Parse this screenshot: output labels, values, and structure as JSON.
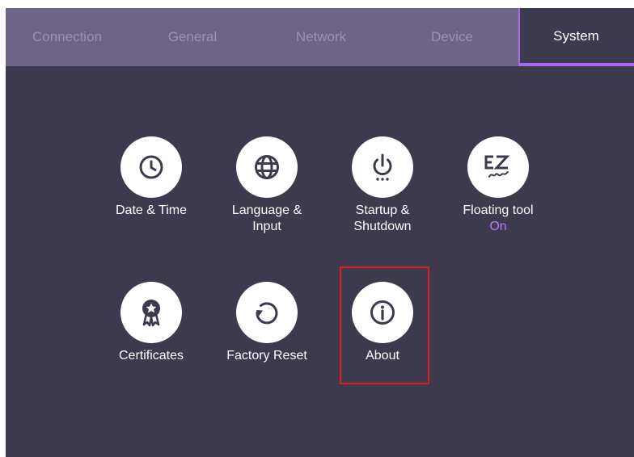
{
  "tabs": [
    {
      "label": "Connection"
    },
    {
      "label": "General"
    },
    {
      "label": "Network"
    },
    {
      "label": "Device"
    },
    {
      "label": "System",
      "active": true
    }
  ],
  "system_items": {
    "date_time": {
      "label": "Date & Time",
      "icon": "clock-icon"
    },
    "language_input": {
      "label_line1": "Language &",
      "label_line2": "Input",
      "icon": "globe-icon"
    },
    "startup_shutdown": {
      "label_line1": "Startup &",
      "label_line2": "Shutdown",
      "icon": "power-icon"
    },
    "floating_tool": {
      "label": "Floating tool",
      "status": "On",
      "icon": "ez-pen-icon"
    },
    "certificates": {
      "label": "Certificates",
      "icon": "award-ribbon-icon"
    },
    "factory_reset": {
      "label": "Factory Reset",
      "icon": "reset-icon"
    },
    "about": {
      "label": "About",
      "icon": "info-icon"
    }
  },
  "colors": {
    "background": "#3e3a4d",
    "tab_bar": "#6e6488",
    "tab_inactive_text": "#9a92ae",
    "accent": "#a66bf2",
    "status_on": "#b57df5",
    "highlight_box": "#d81e1e"
  }
}
